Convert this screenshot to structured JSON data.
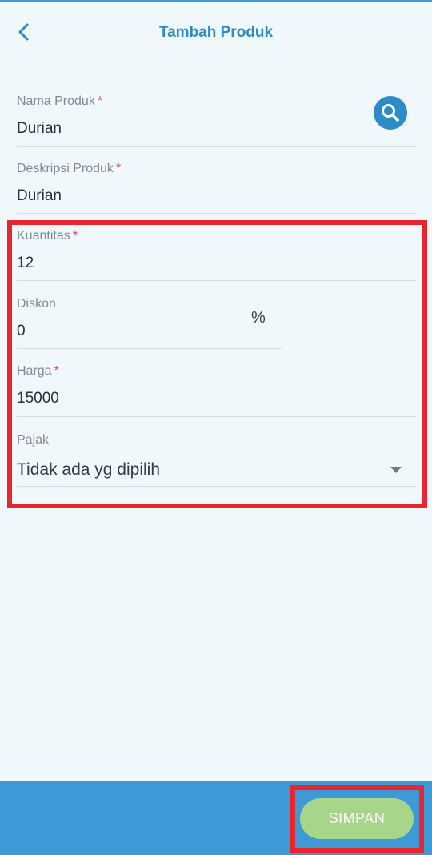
{
  "header": {
    "title": "Tambah Produk",
    "back_icon": "chevron-left-icon"
  },
  "form": {
    "nama_produk": {
      "label": "Nama Produk",
      "required_mark": "*",
      "value": "Durian"
    },
    "deskripsi_produk": {
      "label": "Deskripsi Produk",
      "required_mark": "*",
      "value": "Durian"
    },
    "kuantitas": {
      "label": "Kuantitas",
      "required_mark": "*",
      "value": "12"
    },
    "diskon": {
      "label": "Diskon",
      "value": "0",
      "unit": "%"
    },
    "harga": {
      "label": "Harga",
      "required_mark": "*",
      "value": "15000"
    },
    "pajak": {
      "label": "Pajak",
      "selected": "Tidak ada yg dipilih"
    }
  },
  "search_icon": "search-icon",
  "footer": {
    "save_label": "SIMPAN"
  },
  "colors": {
    "accent": "#2b8cc6",
    "footer_bg": "#3e9ad6",
    "save_button": "#a7d68a",
    "highlight": "#e8262b",
    "required": "#e64545"
  }
}
